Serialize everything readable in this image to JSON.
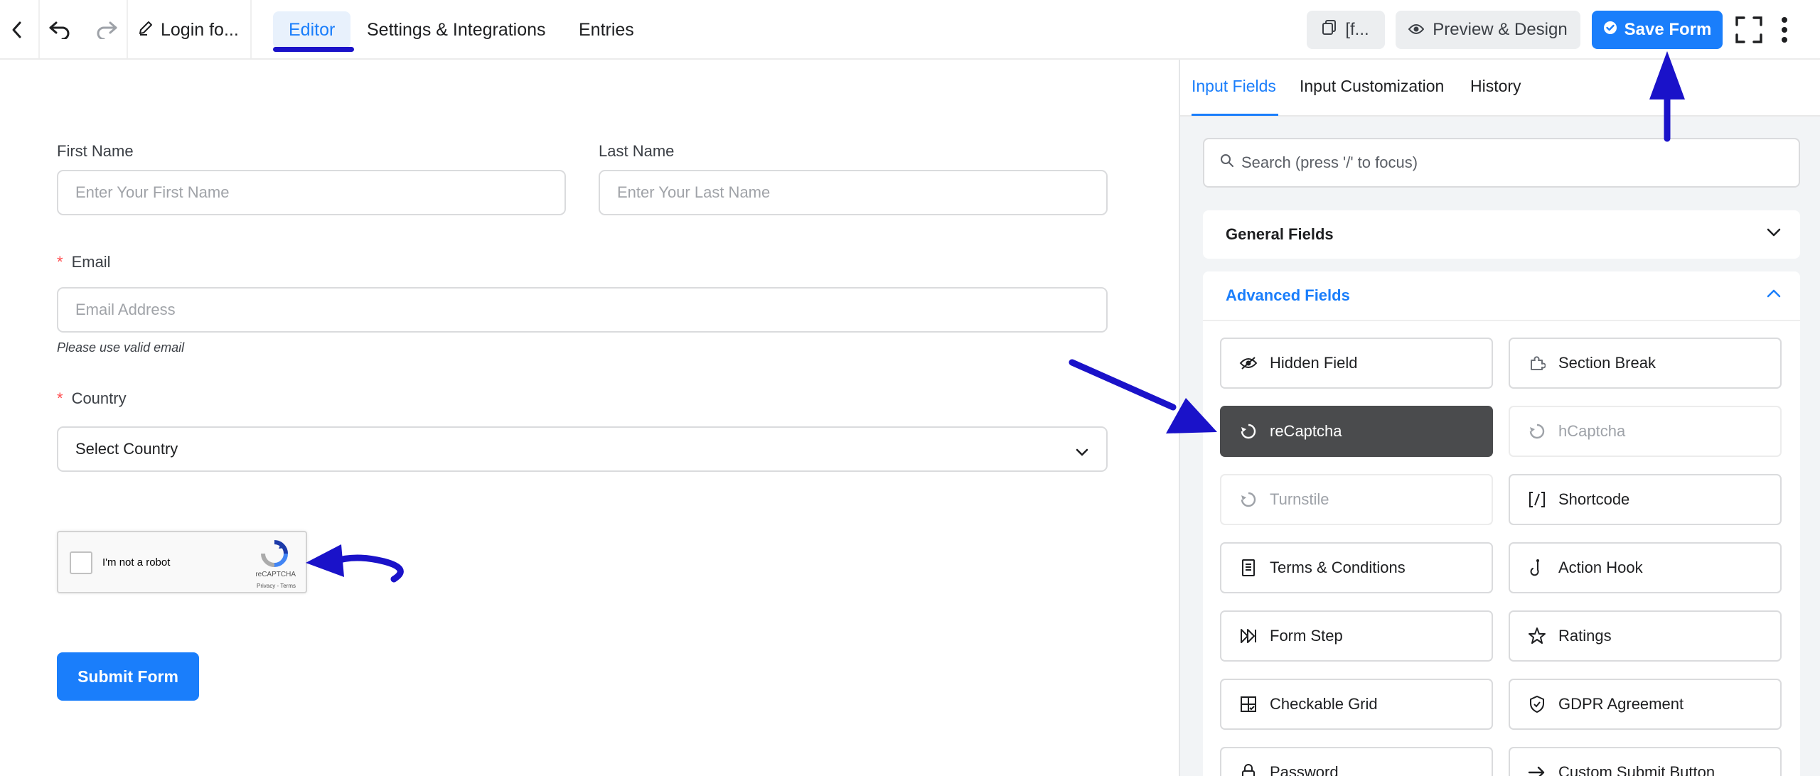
{
  "topbar": {
    "title": "Login fo...",
    "tabs": [
      {
        "label": "Editor"
      },
      {
        "label": "Settings & Integrations"
      },
      {
        "label": "Entries"
      }
    ],
    "shortcode_label": "[f...",
    "preview_label": "Preview & Design",
    "save_label": "Save Form"
  },
  "form": {
    "first_name": {
      "label": "First Name",
      "placeholder": "Enter Your First Name"
    },
    "last_name": {
      "label": "Last Name",
      "placeholder": "Enter Your Last Name"
    },
    "email": {
      "required_mark": "*",
      "label": "Email",
      "placeholder": "Email Address",
      "help": "Please use valid email"
    },
    "country": {
      "required_mark": "*",
      "label": "Country",
      "value": "Select Country"
    },
    "recaptcha": {
      "text": "I'm not a robot",
      "brand": "reCAPTCHA",
      "links": "Privacy - Terms"
    },
    "submit_label": "Submit Form"
  },
  "sidebar": {
    "tabs": [
      {
        "label": "Input Fields"
      },
      {
        "label": "Input Customization"
      },
      {
        "label": "History"
      }
    ],
    "search_placeholder": "Search (press '/' to focus)",
    "general_fields_label": "General Fields",
    "advanced_fields_label": "Advanced Fields",
    "advanced_fields": [
      {
        "label": "Hidden Field",
        "icon": "eye-slash-icon",
        "state": "normal"
      },
      {
        "label": "Section Break",
        "icon": "puzzle-icon",
        "state": "normal"
      },
      {
        "label": "reCaptcha",
        "icon": "recaptcha-icon",
        "state": "active"
      },
      {
        "label": "hCaptcha",
        "icon": "captcha-icon",
        "state": "disabled"
      },
      {
        "label": "Turnstile",
        "icon": "captcha-icon",
        "state": "disabled"
      },
      {
        "label": "Shortcode",
        "icon": "shortcode-icon",
        "state": "normal"
      },
      {
        "label": "Terms & Conditions",
        "icon": "document-icon",
        "state": "normal"
      },
      {
        "label": "Action Hook",
        "icon": "hook-icon",
        "state": "normal"
      },
      {
        "label": "Form Step",
        "icon": "step-forward-icon",
        "state": "normal"
      },
      {
        "label": "Ratings",
        "icon": "star-icon",
        "state": "normal"
      },
      {
        "label": "Checkable Grid",
        "icon": "grid-check-icon",
        "state": "normal"
      },
      {
        "label": "GDPR Agreement",
        "icon": "shield-icon",
        "state": "normal"
      },
      {
        "label": "Password",
        "icon": "lock-icon",
        "state": "normal"
      },
      {
        "label": "Custom Submit Button",
        "icon": "arrow-right-icon",
        "state": "normal"
      }
    ]
  },
  "colors": {
    "accent": "#1a7efb",
    "annotation": "#1a12c9",
    "active_field": "#4a4b4d"
  }
}
